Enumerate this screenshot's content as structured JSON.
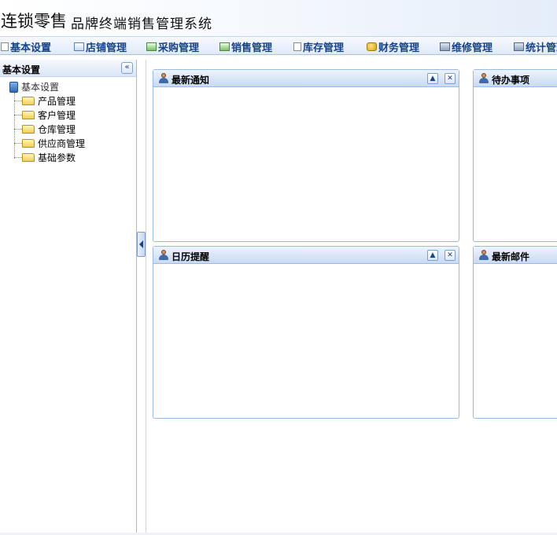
{
  "header": {
    "title_main": "连锁零售",
    "title_sub": "品牌终端销售管理系统"
  },
  "menu": [
    {
      "label": "基本设置",
      "icon": "document-icon"
    },
    {
      "label": "店铺管理",
      "icon": "window-icon"
    },
    {
      "label": "采购管理",
      "icon": "window-icon"
    },
    {
      "label": "销售管理",
      "icon": "window-icon"
    },
    {
      "label": "库存管理",
      "icon": "document-icon"
    },
    {
      "label": "财务管理",
      "icon": "coins-icon"
    },
    {
      "label": "维修管理",
      "icon": "computer-icon"
    },
    {
      "label": "统计管理",
      "icon": "computer-icon"
    }
  ],
  "sidebar": {
    "title": "基本设置",
    "collapse_label": "«",
    "tree_root": "基本设置",
    "items": [
      "产品管理",
      "客户管理",
      "仓库管理",
      "供应商管理",
      "基础参数"
    ]
  },
  "portlets": [
    {
      "title": "最新通知"
    },
    {
      "title": "待办事项"
    },
    {
      "title": "日历提醒"
    },
    {
      "title": "最新邮件"
    }
  ],
  "tools": {
    "collapse": "▲",
    "close": "✕"
  },
  "colors": {
    "accent": "#15428b",
    "border": "#99bbe8",
    "header_bg": "#dfe9f7"
  }
}
